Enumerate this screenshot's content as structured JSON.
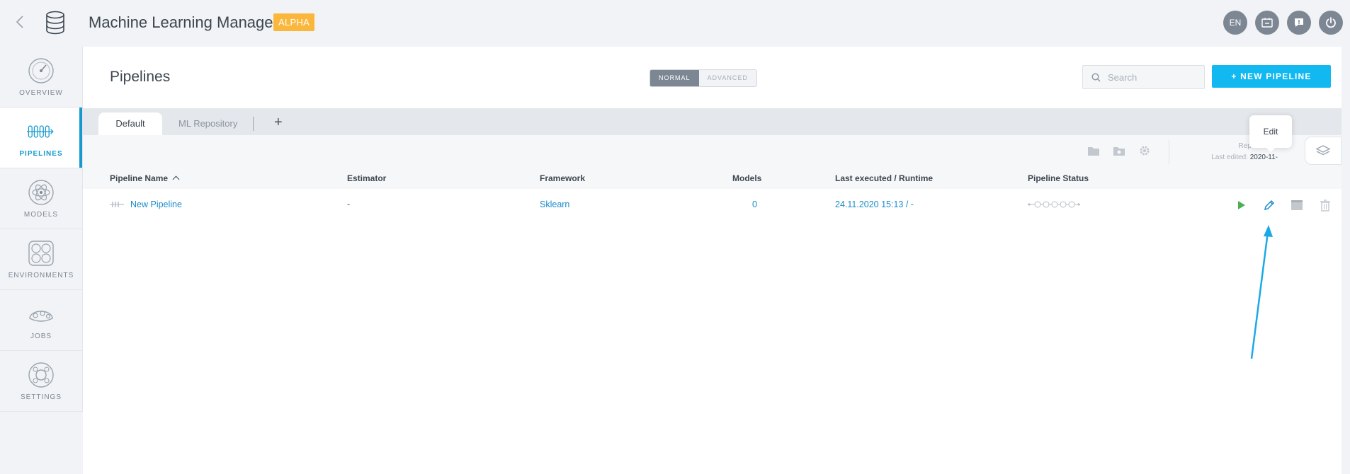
{
  "app": {
    "title": "Machine Learning Manager",
    "badge": "ALPHA"
  },
  "top_icons": {
    "language": "EN",
    "items": [
      "language-button",
      "notebook-icon",
      "feedback-icon",
      "power-icon"
    ]
  },
  "sidebar": {
    "items": [
      {
        "label": "OVERVIEW",
        "icon": "overview-gauge-icon",
        "active": false
      },
      {
        "label": "PIPELINES",
        "icon": "pipelines-icon",
        "active": true
      },
      {
        "label": "MODELS",
        "icon": "models-atom-icon",
        "active": false
      },
      {
        "label": "ENVIRONMENTS",
        "icon": "environments-icon",
        "active": false
      },
      {
        "label": "JOBS",
        "icon": "jobs-icon",
        "active": false
      },
      {
        "label": "SETTINGS",
        "icon": "settings-gear-icon",
        "active": false
      }
    ]
  },
  "header": {
    "page_title": "Pipelines",
    "mode_normal": "NORMAL",
    "mode_advanced": "ADVANCED",
    "search_placeholder": "Search",
    "new_button": "+   NEW PIPELINE"
  },
  "tabs": {
    "items": [
      {
        "label": "Default"
      },
      {
        "label": "ML Repository"
      }
    ],
    "add": "+"
  },
  "toolbar": {
    "repo_label": "Repository v",
    "last_edited_label": "Last edited:",
    "last_edited_value": "2020-11-"
  },
  "table": {
    "headers": [
      "Pipeline Name",
      "Estimator",
      "Framework",
      "Models",
      "Last executed / Runtime",
      "Pipeline Status"
    ],
    "rows": [
      {
        "name": "New Pipeline",
        "estimator": "-",
        "framework": "Sklearn",
        "models": "0",
        "last_executed": "24.11.2020 15:13 / -"
      }
    ]
  },
  "tooltip": {
    "text": "Edit"
  },
  "colors": {
    "accent": "#12b8f0",
    "link": "#1a8cc8",
    "badge": "#fbb73b",
    "play": "#4caf50",
    "arrow": "#1ba9e6"
  }
}
